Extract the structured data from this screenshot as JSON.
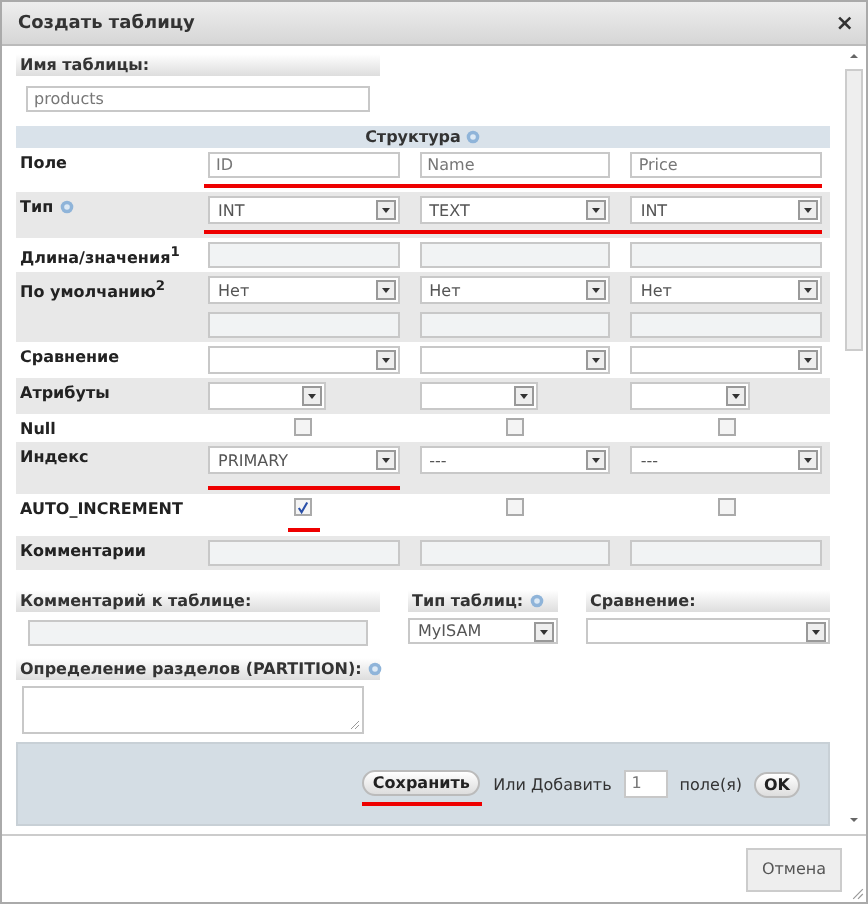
{
  "window": {
    "title": "Создать таблицу",
    "close": "×"
  },
  "table_name": {
    "label": "Имя таблицы:",
    "value": "products"
  },
  "structure": {
    "title": "Структура",
    "help": true,
    "rows": [
      {
        "label": "Поле",
        "kind": "input",
        "underlined": true,
        "cells": [
          {
            "value": "ID"
          },
          {
            "value": "Name"
          },
          {
            "value": "Price"
          }
        ]
      },
      {
        "label": "Тип",
        "help": true,
        "kind": "select",
        "underlined": true,
        "cells": [
          {
            "value": "INT"
          },
          {
            "value": "TEXT"
          },
          {
            "value": "INT"
          }
        ]
      },
      {
        "label": "Длина/значения$^{1}$",
        "kind": "input",
        "underlined": false,
        "cells": [
          {},
          {},
          {}
        ]
      },
      {
        "label": "По умолчанию$^{2}$",
        "kind": "select_input",
        "underlined": false,
        "cells": [
          {
            "value": "Нет"
          },
          {
            "value": "Нет"
          },
          {
            "value": "Нет"
          }
        ]
      },
      {
        "label": "Сравнение",
        "kind": "select",
        "underlined": false,
        "cells": [
          {},
          {},
          {}
        ]
      },
      {
        "label": "Атрибуты",
        "kind": "short_select",
        "underlined": false,
        "cells": [
          {},
          {},
          {}
        ]
      },
      {
        "label": "Null",
        "kind": "checkbox",
        "underlined": false,
        "cells": [
          {
            "checked": false
          },
          {
            "checked": false
          },
          {
            "checked": false
          }
        ]
      },
      {
        "label": "Индекс",
        "kind": "select",
        "underlined": false,
        "cells": [
          {
            "value": "PRIMARY",
            "underlined": true
          },
          {
            "value": "---",
            "underlined": false
          },
          {
            "value": "---",
            "underlined": false
          }
        ]
      },
      {
        "label": "AUTO_INCREMENT",
        "kind": "checkbox",
        "underlined": false,
        "cells": [
          {
            "checked": true,
            "underlined": true
          },
          {
            "checked": false,
            "underlined": false
          },
          {
            "checked": false,
            "underlined": false
          }
        ]
      },
      {
        "label": "Комментарии",
        "kind": "input",
        "underlined": false,
        "cells": [
          {},
          {},
          {}
        ]
      }
    ]
  },
  "table_comment": {
    "label": "Комментарий к таблице:"
  },
  "table_type": {
    "label": "Тип таблиц:",
    "help": true,
    "value": "MyISAM"
  },
  "collation": {
    "label": "Сравнение:"
  },
  "partition": {
    "label": "Определение разделов (PARTITION):",
    "help": true
  },
  "actions": {
    "save": "Сохранить",
    "save_underlined": true,
    "or_add": "Или Добавить",
    "count": "1",
    "fields": "поле(я)",
    "ok": "OK"
  },
  "footer": {
    "cancel": "Отмена"
  }
}
